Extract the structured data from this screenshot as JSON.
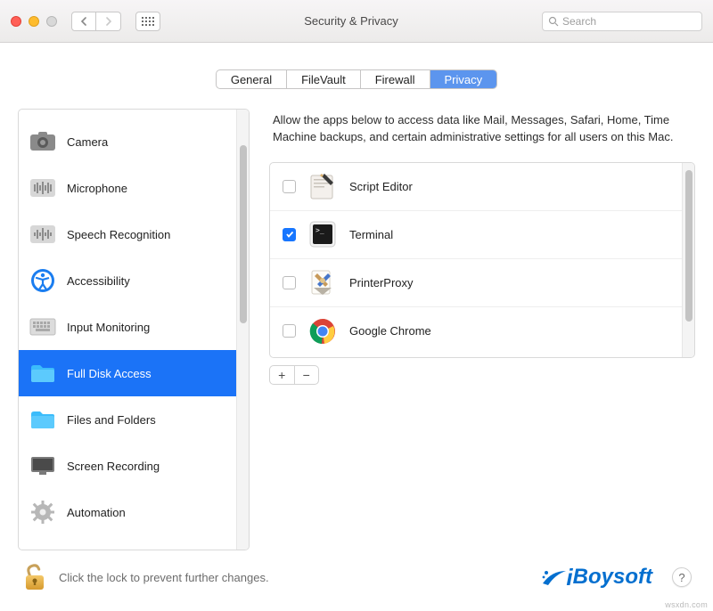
{
  "window": {
    "title": "Security & Privacy"
  },
  "search": {
    "placeholder": "Search"
  },
  "tabs": [
    {
      "label": "General"
    },
    {
      "label": "FileVault"
    },
    {
      "label": "Firewall"
    },
    {
      "label": "Privacy",
      "active": true
    }
  ],
  "sidebar": {
    "items": [
      {
        "label": "Camera",
        "icon": "camera"
      },
      {
        "label": "Microphone",
        "icon": "mic"
      },
      {
        "label": "Speech Recognition",
        "icon": "speech"
      },
      {
        "label": "Accessibility",
        "icon": "accessibility"
      },
      {
        "label": "Input Monitoring",
        "icon": "keyboard"
      },
      {
        "label": "Full Disk Access",
        "icon": "folder",
        "selected": true
      },
      {
        "label": "Files and Folders",
        "icon": "folder"
      },
      {
        "label": "Screen Recording",
        "icon": "screen"
      },
      {
        "label": "Automation",
        "icon": "gear"
      }
    ]
  },
  "description": "Allow the apps below to access data like Mail, Messages, Safari, Home, Time Machine backups, and certain administrative settings for all users on this Mac.",
  "apps": [
    {
      "label": "Script Editor",
      "checked": false,
      "icon": "script"
    },
    {
      "label": "Terminal",
      "checked": true,
      "icon": "terminal"
    },
    {
      "label": "PrinterProxy",
      "checked": false,
      "icon": "printer"
    },
    {
      "label": "Google Chrome",
      "checked": false,
      "icon": "chrome"
    }
  ],
  "buttons": {
    "add": "+",
    "remove": "−"
  },
  "footer": {
    "text": "Click the lock to prevent further changes."
  },
  "brand": "Boysoft",
  "watermark": "wsxdn.com",
  "help": "?"
}
